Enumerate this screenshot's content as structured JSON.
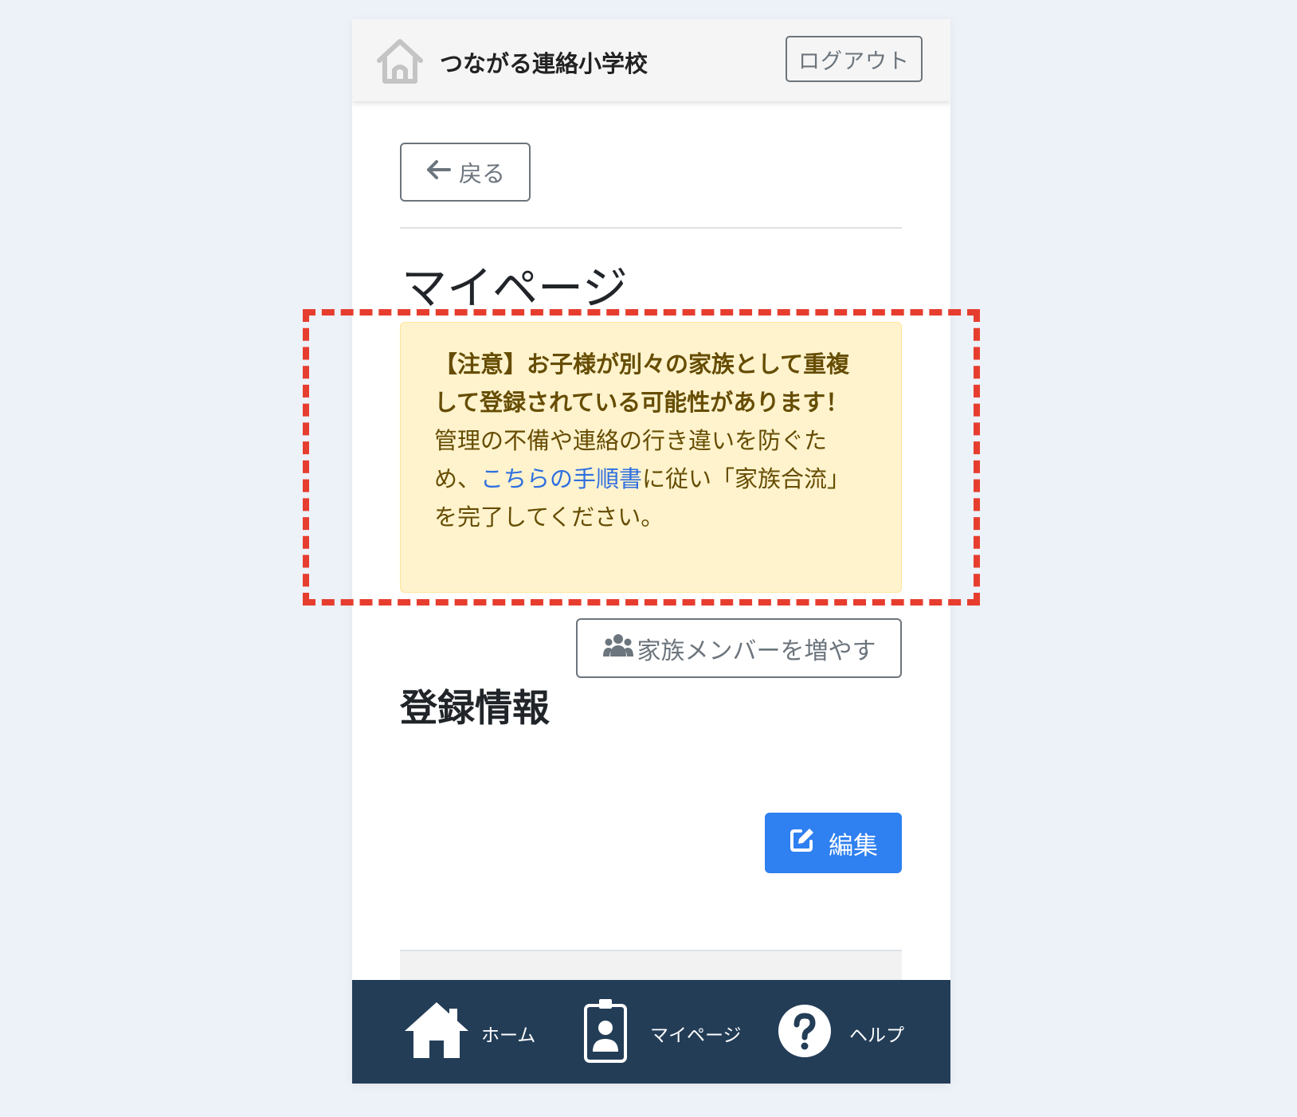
{
  "header": {
    "school_name": "つながる連絡小学校",
    "logout_label": "ログアウト"
  },
  "nav": {
    "back_label": "戻る"
  },
  "page": {
    "title": "マイページ"
  },
  "alert": {
    "warning_text": "【注意】お子様が別々の家族として重複して登録されている可能性があります！",
    "body_before_link": "管理の不備や連絡の行き違いを防ぐため、",
    "link_text": "こちらの手順書",
    "body_after_link": "に従い「家族合流」を完了してください。"
  },
  "actions": {
    "add_family_label": "家族メンバーを増やす",
    "edit_label": "編集"
  },
  "sections": {
    "registration_title": "登録情報"
  },
  "bottom_nav": {
    "home_label": "ホーム",
    "mypage_label": "マイページ",
    "help_label": "ヘルプ"
  },
  "icons": {
    "home_logo": "home-outline-icon",
    "back": "arrow-left-icon",
    "family": "users-icon",
    "edit": "pen-to-square-icon",
    "nav_home": "home-icon",
    "nav_mypage": "id-badge-icon",
    "nav_help": "question-circle-icon"
  },
  "colors": {
    "page_background": "#edf1f8",
    "alert_background": "#fff3cd",
    "alert_text": "#664d03",
    "link": "#2f6fe0",
    "highlight_dash": "#e63d2f",
    "primary": "#2f80f0",
    "nav_background": "#233d57"
  }
}
